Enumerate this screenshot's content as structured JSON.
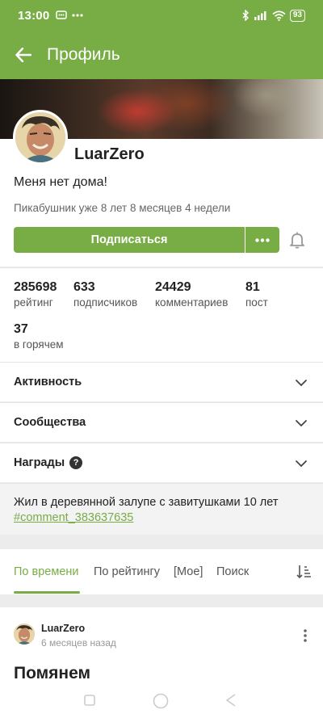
{
  "status_bar": {
    "time": "13:00",
    "battery": "93"
  },
  "app_bar": {
    "title": "Профиль"
  },
  "profile": {
    "username": "LuarZero",
    "status_message": "Меня нет дома!",
    "tenure": "Пикабушник уже 8 лет 8 месяцев 4 недели",
    "subscribe_label": "Подписаться",
    "more_label": "•••"
  },
  "stats": [
    {
      "value": "285698",
      "label": "рейтинг"
    },
    {
      "value": "633",
      "label": "подписчиков"
    },
    {
      "value": "24429",
      "label": "комментариев"
    },
    {
      "value": "81",
      "label": "пост"
    },
    {
      "value": "37",
      "label": "в горячем"
    }
  ],
  "sections": [
    {
      "label": "Активность"
    },
    {
      "label": "Сообщества"
    },
    {
      "label": "Награды"
    }
  ],
  "note": {
    "text": "Жил в деревянной залупе с завитушками 10 лет",
    "link": "#comment_383637635"
  },
  "tabs": [
    {
      "label": "По времени",
      "active": true
    },
    {
      "label": "По рейтингу"
    },
    {
      "label": "[Мое]"
    },
    {
      "label": "Поиск"
    }
  ],
  "post": {
    "author": "LuarZero",
    "time": "6 месяцев назад",
    "title": "Помянем"
  },
  "colors": {
    "accent": "#78ad45"
  }
}
